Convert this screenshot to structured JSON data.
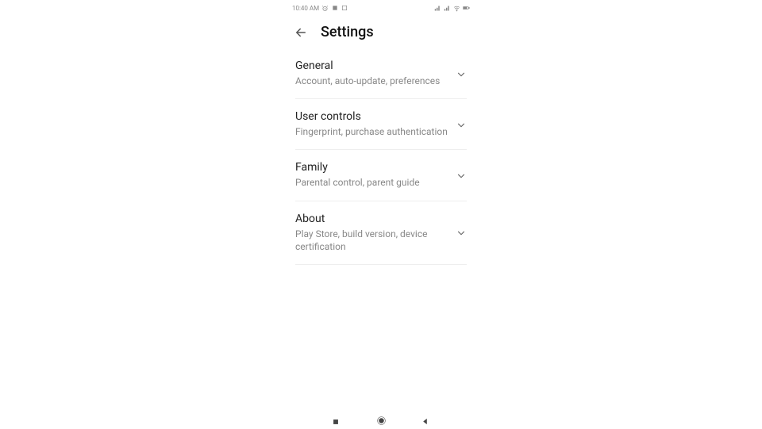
{
  "status": {
    "time": "10:40 AM"
  },
  "header": {
    "title": "Settings"
  },
  "items": [
    {
      "title": "General",
      "sub": "Account, auto-update, preferences"
    },
    {
      "title": "User controls",
      "sub": "Fingerprint, purchase authentication"
    },
    {
      "title": "Family",
      "sub": "Parental control, parent guide"
    },
    {
      "title": "About",
      "sub": "Play Store, build version, device certification"
    }
  ]
}
